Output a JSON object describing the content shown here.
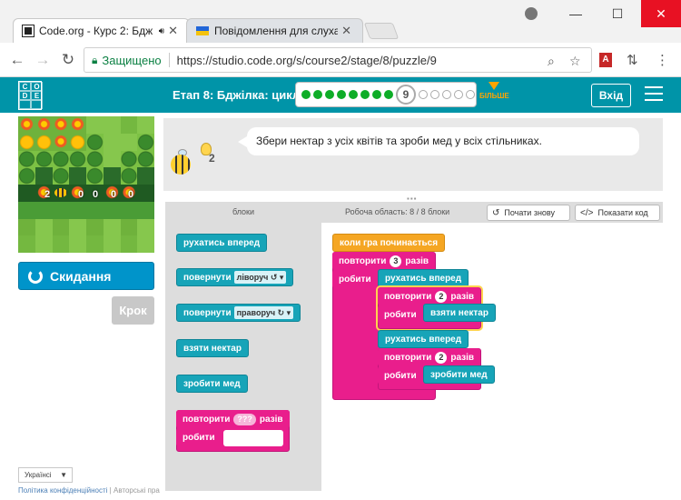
{
  "browser": {
    "tabs": [
      {
        "title": "Code.org - Курс 2: Бдж",
        "active": true
      },
      {
        "title": "Повідомлення для слуха",
        "active": false
      }
    ],
    "secure_label": "Защищено",
    "url": "https://studio.code.org/s/course2/stage/8/puzzle/9",
    "window_controls": [
      "minimize",
      "maximize",
      "close"
    ]
  },
  "header": {
    "logo_letters": [
      "C",
      "O",
      "D",
      "E",
      "",
      ""
    ],
    "stage_label": "Етап 8: Бджілка: цикли",
    "progress": {
      "completed": 8,
      "current": "9",
      "remaining": 5
    },
    "more_label": "БІЛЬШЕ",
    "signin_label": "Вхід",
    "accent": "#0094a8"
  },
  "maze": {
    "numbers": [
      "2",
      "0",
      "0",
      "0",
      "0"
    ]
  },
  "controls": {
    "reset_label": "Скидання",
    "step_label": "Крок"
  },
  "instructions": {
    "text": "Збери нектар з усіх квітів та зроби мед у всіх стільниках.",
    "hint_count": "2"
  },
  "workspace": {
    "blocks_label": "блоки",
    "workspace_label": "Робоча область: 8 / 8 блоки",
    "restart_label": "Почати знову",
    "show_code_label": "Показати код"
  },
  "toolbox": {
    "move_forward": "рухатись вперед",
    "turn_left": {
      "prefix": "повернути",
      "value": "ліворуч ↺ ▾"
    },
    "turn_right": {
      "prefix": "повернути",
      "value": "праворуч ↻ ▾"
    },
    "get_nectar": "взяти нектар",
    "make_honey": "зробити мед",
    "repeat": {
      "prefix": "повторити",
      "value": "???",
      "suffix": "разів",
      "do": "робити"
    }
  },
  "program": {
    "when_run": "коли гра починається",
    "repeat_outer": {
      "prefix": "повторити",
      "value": "3",
      "suffix": "разів",
      "do": "робити"
    },
    "move1": "рухатись вперед",
    "repeat_inner1": {
      "prefix": "повторити",
      "value": "2",
      "suffix": "разів",
      "do": "робити"
    },
    "get_nectar": "взяти нектар",
    "move2": "рухатись вперед",
    "repeat_inner2": {
      "prefix": "повторити",
      "value": "2",
      "suffix": "разів",
      "do": "робити"
    },
    "make_honey": "зробити мед"
  },
  "footer": {
    "language": "Українсі",
    "privacy": "Політика конфіденційності",
    "separator": "|",
    "copyright": "Авторські пра"
  }
}
